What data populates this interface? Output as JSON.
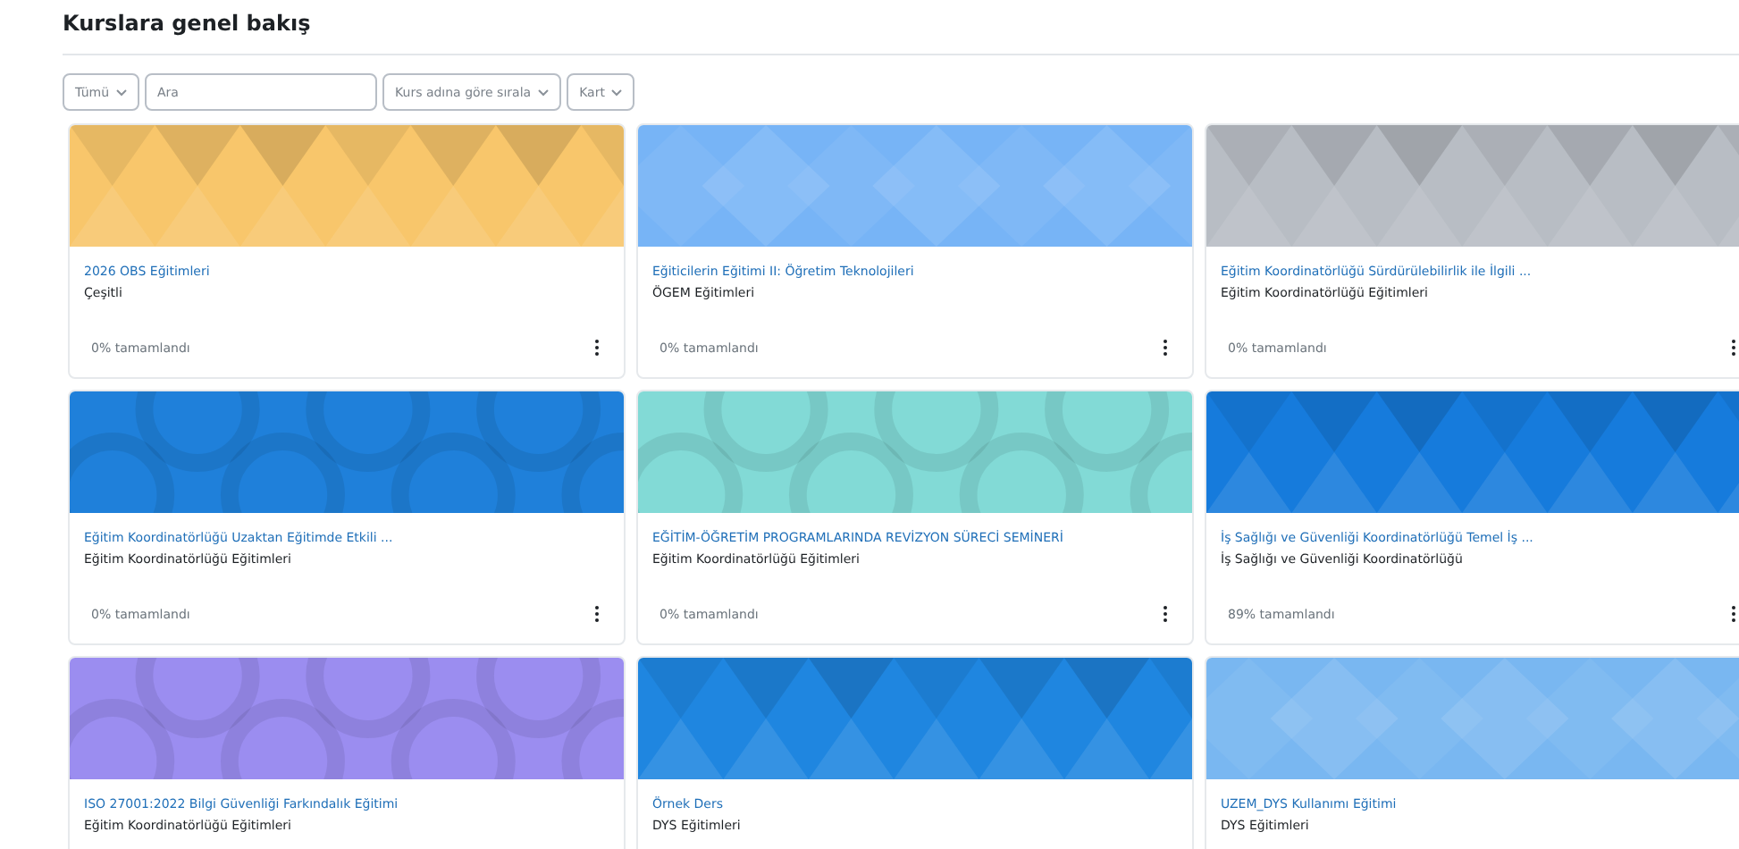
{
  "heading": "Kurslara genel bakış",
  "filters": [
    {
      "kind": "dropdown",
      "label": "Tümü"
    },
    {
      "kind": "search",
      "placeholder": "Ara"
    },
    {
      "kind": "dropdown",
      "label": "Kurs adına göre sırala"
    },
    {
      "kind": "dropdown",
      "label": "Kart"
    }
  ],
  "courses": [
    {
      "title": "2026 OBS Eğitimleri",
      "category": "Çeşitli",
      "progress": "0% tamamlandı",
      "color": "#f8c66b",
      "kind": "triangles"
    },
    {
      "title": "Eğiticilerin Eğitimi II: Öğretim Teknolojileri",
      "category": "ÖGEM Eğitimleri",
      "progress": "0% tamamlandı",
      "color": "#77b4f6",
      "kind": "diamonds"
    },
    {
      "title": "Eğitim Koordinatörlüğü Sürdürülebilirlik ile İlgili ...",
      "category": "Eğitim Koordinatörlüğü Eğitimleri",
      "progress": "0% tamamlandı",
      "color": "#b8bdc4",
      "kind": "triangles"
    },
    {
      "title": "Eğitim Koordinatörlüğü Uzaktan Eğitimde Etkili ...",
      "category": "Eğitim Koordinatörlüğü Eğitimleri",
      "progress": "0% tamamlandı",
      "color": "#1f80da",
      "kind": "circles"
    },
    {
      "title": "EĞİTİM-ÖĞRETİM PROGRAMLARINDA REVİZYON SÜRECİ SEMİNERİ",
      "category": "Eğitim Koordinatörlüğü Eğitimleri",
      "progress": "0% tamamlandı",
      "color": "#82dad6",
      "kind": "circles"
    },
    {
      "title": "İş Sağlığı ve Güvenliği Koordinatörlüğü Temel İş ...",
      "category": "İş Sağlığı ve Güvenliği Koordinatörlüğü",
      "progress": "89% tamamlandı",
      "color": "#167bdc",
      "kind": "triangles"
    },
    {
      "title": "ISO 27001:2022 Bilgi Güvenliği Farkındalık Eğitimi",
      "category": "Eğitim Koordinatörlüğü Eğitimleri",
      "color": "#9b8df0",
      "kind": "circles"
    },
    {
      "title": "Örnek Ders",
      "category": "DYS Eğitimleri",
      "color": "#1f86e0",
      "kind": "triangles"
    },
    {
      "title": "UZEM_DYS Kullanımı Eğitimi",
      "category": "DYS Eğitimleri",
      "color": "#79b7f1",
      "kind": "diamonds"
    }
  ]
}
